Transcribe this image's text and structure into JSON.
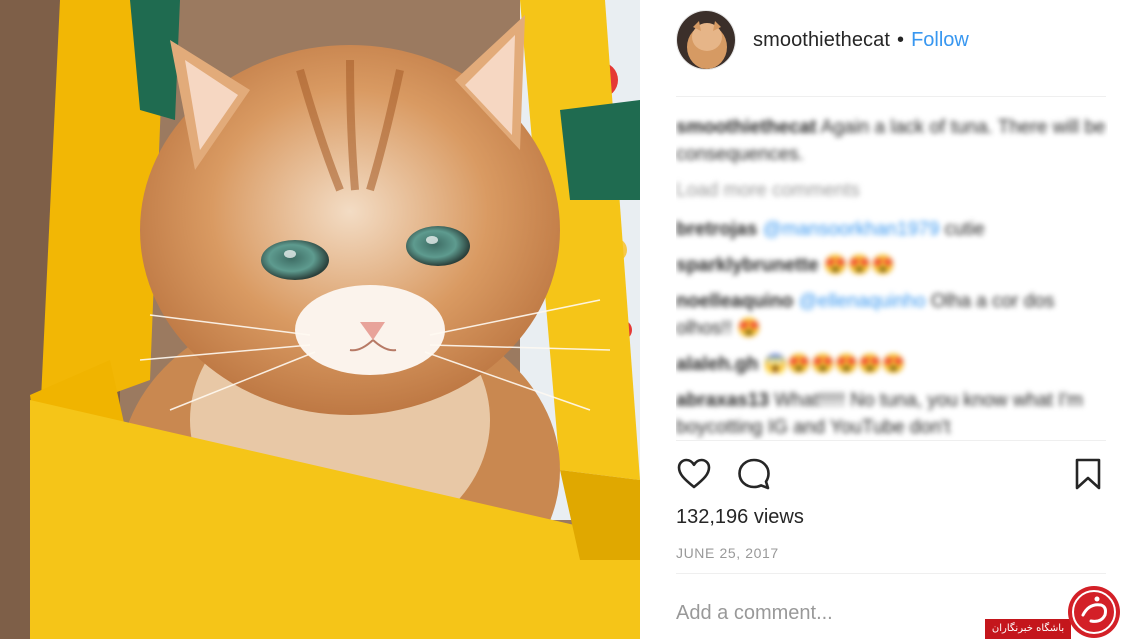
{
  "post": {
    "username": "smoothiethecat",
    "separator": "•",
    "follow_label": "Follow",
    "views": "132,196 views",
    "date": "JUNE 25, 2017",
    "add_comment_placeholder": "Add a comment...",
    "colors": {
      "accent": "#3897f0",
      "muted": "#999999",
      "text": "#262626",
      "bag_yellow": "#f5c518"
    }
  },
  "caption": {
    "user": "smoothiethecat",
    "text": "Again a lack of tuna. There will be consequences."
  },
  "load_more_label": "Load more comments",
  "comments": [
    {
      "user": "bretrojas",
      "mention": "@mansoorkhan1979",
      "text": "cutie"
    },
    {
      "user": "sparklybrunette",
      "mention": "",
      "text": "😍😍😍"
    },
    {
      "user": "noelleaquino",
      "mention": "@ellenaquinho",
      "text": "Olha a cor dos olhos!! 😍"
    },
    {
      "user": "alaleh.gh",
      "mention": "",
      "text": "😱😍😍😍😍😍"
    },
    {
      "user": "abraxas13",
      "mention": "",
      "text": "What!!!!! No tuna, you know what I'm boycotting IG and YouTube don't"
    }
  ],
  "icons": {
    "like": "heart-icon",
    "comment": "comment-bubble-icon",
    "save": "bookmark-icon"
  },
  "watermark": {
    "text": "باشگاه خبرنگاران"
  }
}
